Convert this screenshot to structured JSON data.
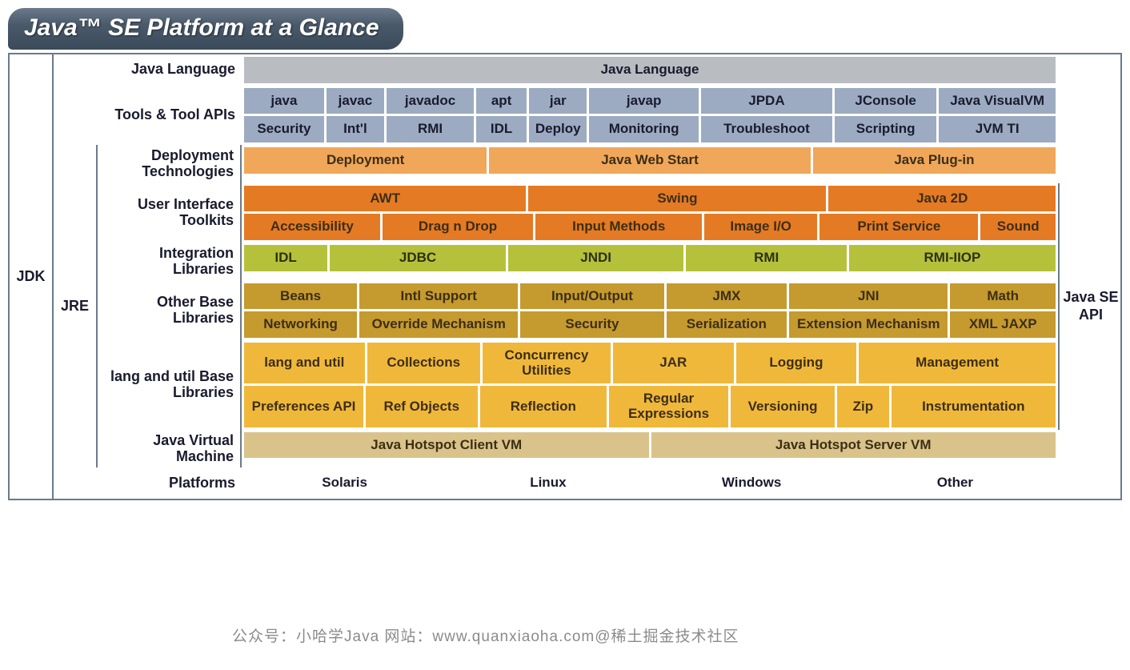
{
  "title": "Java™ SE Platform at a Glance",
  "sideLabels": {
    "jdk": "JDK",
    "jre": "JRE",
    "api": "Java SE API"
  },
  "rows": {
    "javaLanguage": {
      "label": "Java Language",
      "cells": [
        "Java Language"
      ]
    },
    "toolsApis": {
      "label": "Tools & Tool APIs",
      "row1": [
        "java",
        "javac",
        "javadoc",
        "apt",
        "jar",
        "javap",
        "JPDA",
        "JConsole",
        "Java VisualVM"
      ],
      "row2": [
        "Security",
        "Int'l",
        "RMI",
        "IDL",
        "Deploy",
        "Monitoring",
        "Troubleshoot",
        "Scripting",
        "JVM TI"
      ]
    },
    "deployment": {
      "label": "Deployment Technologies",
      "cells": [
        "Deployment",
        "Java Web Start",
        "Java Plug-in"
      ]
    },
    "uiToolkits": {
      "label": "User Interface Toolkits",
      "row1": [
        "AWT",
        "Swing",
        "Java 2D"
      ],
      "row2": [
        "Accessibility",
        "Drag n Drop",
        "Input Methods",
        "Image I/O",
        "Print Service",
        "Sound"
      ]
    },
    "integration": {
      "label": "Integration Libraries",
      "cells": [
        "IDL",
        "JDBC",
        "JNDI",
        "RMI",
        "RMI-IIOP"
      ]
    },
    "otherBase": {
      "label": "Other Base Libraries",
      "row1": [
        "Beans",
        "Intl Support",
        "Input/Output",
        "JMX",
        "JNI",
        "Math"
      ],
      "row2": [
        "Networking",
        "Override Mechanism",
        "Security",
        "Serialization",
        "Extension Mechanism",
        "XML JAXP"
      ]
    },
    "langUtil": {
      "label": "lang and util Base Libraries",
      "row1": [
        "lang and util",
        "Collections",
        "Concurrency Utilities",
        "JAR",
        "Logging",
        "Management"
      ],
      "row2": [
        "Preferences API",
        "Ref Objects",
        "Reflection",
        "Regular Expressions",
        "Versioning",
        "Zip",
        "Instrumentation"
      ]
    },
    "jvm": {
      "label": "Java Virtual Machine",
      "cells": [
        "Java Hotspot Client VM",
        "Java Hotspot Server VM"
      ]
    },
    "platforms": {
      "label": "Platforms",
      "cells": [
        "Solaris",
        "Linux",
        "Windows",
        "Other"
      ]
    }
  },
  "watermark": "公众号：小哈学Java  网站：www.quanxiaoha.com@稀土掘金技术社区"
}
